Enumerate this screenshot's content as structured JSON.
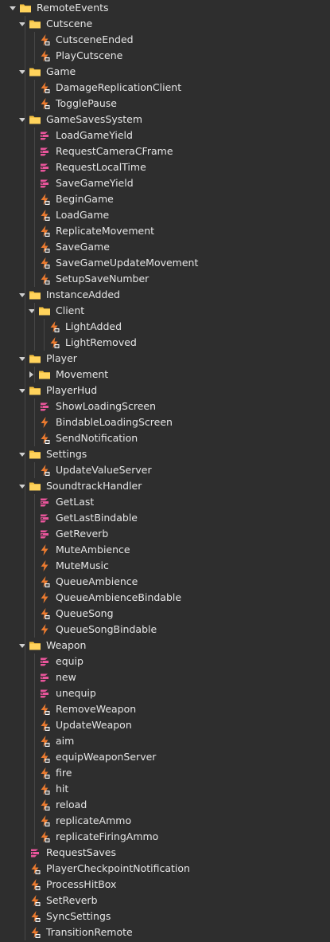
{
  "explorer": {
    "items": [
      {
        "label": "RemoteEvents",
        "depth": 0,
        "type": "folder",
        "expanded": true
      },
      {
        "label": "Cutscene",
        "depth": 1,
        "type": "folder",
        "expanded": true
      },
      {
        "label": "CutsceneEnded",
        "depth": 2,
        "type": "remote-event"
      },
      {
        "label": "PlayCutscene",
        "depth": 2,
        "type": "remote-event"
      },
      {
        "label": "Game",
        "depth": 1,
        "type": "folder",
        "expanded": true
      },
      {
        "label": "DamageReplicationClient",
        "depth": 2,
        "type": "remote-event"
      },
      {
        "label": "TogglePause",
        "depth": 2,
        "type": "remote-event"
      },
      {
        "label": "GameSavesSystem",
        "depth": 1,
        "type": "folder",
        "expanded": true
      },
      {
        "label": "LoadGameYield",
        "depth": 2,
        "type": "remote-function"
      },
      {
        "label": "RequestCameraCFrame",
        "depth": 2,
        "type": "remote-function"
      },
      {
        "label": "RequestLocalTime",
        "depth": 2,
        "type": "remote-function"
      },
      {
        "label": "SaveGameYield",
        "depth": 2,
        "type": "remote-function"
      },
      {
        "label": "BeginGame",
        "depth": 2,
        "type": "remote-event"
      },
      {
        "label": "LoadGame",
        "depth": 2,
        "type": "remote-event"
      },
      {
        "label": "ReplicateMovement",
        "depth": 2,
        "type": "remote-event"
      },
      {
        "label": "SaveGame",
        "depth": 2,
        "type": "remote-event"
      },
      {
        "label": "SaveGameUpdateMovement",
        "depth": 2,
        "type": "remote-event"
      },
      {
        "label": "SetupSaveNumber",
        "depth": 2,
        "type": "remote-event"
      },
      {
        "label": "InstanceAdded",
        "depth": 1,
        "type": "folder",
        "expanded": true
      },
      {
        "label": "Client",
        "depth": 2,
        "type": "folder",
        "expanded": true
      },
      {
        "label": "LightAdded",
        "depth": 3,
        "type": "remote-event"
      },
      {
        "label": "LightRemoved",
        "depth": 3,
        "type": "remote-event"
      },
      {
        "label": "Player",
        "depth": 1,
        "type": "folder",
        "expanded": true
      },
      {
        "label": "Movement",
        "depth": 2,
        "type": "folder",
        "expanded": false
      },
      {
        "label": "PlayerHud",
        "depth": 1,
        "type": "folder",
        "expanded": true
      },
      {
        "label": "ShowLoadingScreen",
        "depth": 2,
        "type": "remote-function"
      },
      {
        "label": "BindableLoadingScreen",
        "depth": 2,
        "type": "bindable-event"
      },
      {
        "label": "SendNotification",
        "depth": 2,
        "type": "remote-event"
      },
      {
        "label": "Settings",
        "depth": 1,
        "type": "folder",
        "expanded": true
      },
      {
        "label": "UpdateValueServer",
        "depth": 2,
        "type": "remote-event"
      },
      {
        "label": "SoundtrackHandler",
        "depth": 1,
        "type": "folder",
        "expanded": true
      },
      {
        "label": "GetLast",
        "depth": 2,
        "type": "remote-function"
      },
      {
        "label": "GetLastBindable",
        "depth": 2,
        "type": "remote-function"
      },
      {
        "label": "GetReverb",
        "depth": 2,
        "type": "remote-function"
      },
      {
        "label": "MuteAmbience",
        "depth": 2,
        "type": "bindable-event"
      },
      {
        "label": "MuteMusic",
        "depth": 2,
        "type": "bindable-event"
      },
      {
        "label": "QueueAmbience",
        "depth": 2,
        "type": "remote-event"
      },
      {
        "label": "QueueAmbienceBindable",
        "depth": 2,
        "type": "bindable-event"
      },
      {
        "label": "QueueSong",
        "depth": 2,
        "type": "remote-event"
      },
      {
        "label": "QueueSongBindable",
        "depth": 2,
        "type": "bindable-event"
      },
      {
        "label": "Weapon",
        "depth": 1,
        "type": "folder",
        "expanded": true
      },
      {
        "label": "equip",
        "depth": 2,
        "type": "remote-function"
      },
      {
        "label": "new",
        "depth": 2,
        "type": "remote-function"
      },
      {
        "label": "unequip",
        "depth": 2,
        "type": "remote-function"
      },
      {
        "label": "RemoveWeapon",
        "depth": 2,
        "type": "remote-event"
      },
      {
        "label": "UpdateWeapon",
        "depth": 2,
        "type": "remote-event"
      },
      {
        "label": "aim",
        "depth": 2,
        "type": "remote-event"
      },
      {
        "label": "equipWeaponServer",
        "depth": 2,
        "type": "remote-event"
      },
      {
        "label": "fire",
        "depth": 2,
        "type": "remote-event"
      },
      {
        "label": "hit",
        "depth": 2,
        "type": "remote-event"
      },
      {
        "label": "reload",
        "depth": 2,
        "type": "remote-event"
      },
      {
        "label": "replicateAmmo",
        "depth": 2,
        "type": "remote-event"
      },
      {
        "label": "replicateFiringAmmo",
        "depth": 2,
        "type": "remote-event"
      },
      {
        "label": "RequestSaves",
        "depth": 1,
        "type": "remote-function"
      },
      {
        "label": "PlayerCheckpointNotification",
        "depth": 1,
        "type": "remote-event"
      },
      {
        "label": "ProcessHitBox",
        "depth": 1,
        "type": "remote-event"
      },
      {
        "label": "SetReverb",
        "depth": 1,
        "type": "remote-event"
      },
      {
        "label": "SyncSettings",
        "depth": 1,
        "type": "remote-event"
      },
      {
        "label": "TransitionRemote",
        "depth": 1,
        "type": "remote-event"
      }
    ]
  },
  "colors": {
    "background": "#2e2e2e",
    "text": "#e6e6e6",
    "folder": "#f5c242",
    "remote_event": "#ea7a2f",
    "remote_function": "#e9559b",
    "guide": "#474747"
  }
}
